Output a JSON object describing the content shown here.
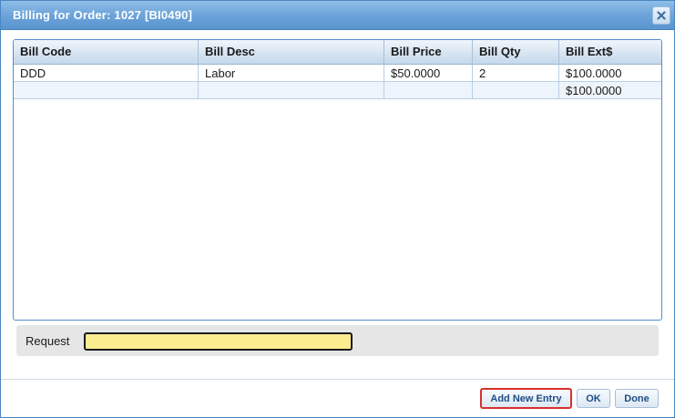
{
  "dialog": {
    "title": "Billing for Order: 1027 [BI0490]",
    "close_icon": "close-icon"
  },
  "grid": {
    "columns": [
      "Bill Code",
      "Bill Desc",
      "Bill Price",
      "Bill Qty",
      "Bill Ext$"
    ],
    "rows": [
      [
        "DDD",
        "Labor",
        "$50.0000",
        "2",
        "$100.0000"
      ]
    ],
    "total_row": [
      "",
      "",
      "",
      "",
      "$100.0000"
    ]
  },
  "request": {
    "label": "Request",
    "value": ""
  },
  "footer": {
    "add_new_entry": "Add New Entry",
    "ok": "OK",
    "done": "Done"
  },
  "colors": {
    "titlebar": "#6fa6db",
    "request_field": "#fbec90",
    "highlight_border": "#d9302c",
    "button_text": "#1f4e86"
  }
}
